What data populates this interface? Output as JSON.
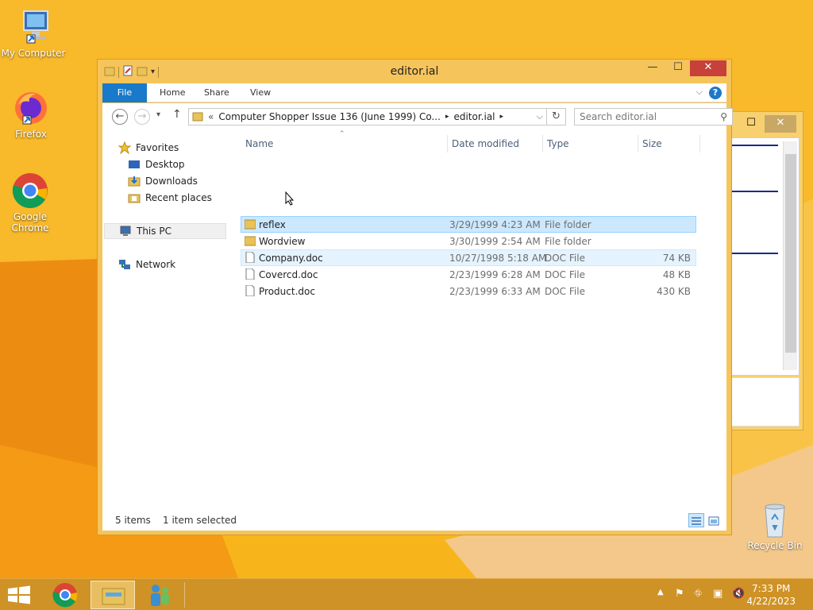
{
  "desktop": {
    "icons": [
      {
        "label": "My Computer"
      },
      {
        "label": "Firefox"
      },
      {
        "label": "Google Chrome"
      },
      {
        "label": "Recycle Bin"
      }
    ]
  },
  "window": {
    "title": "editor.ial",
    "ribbon_tabs": [
      "File",
      "Home",
      "Share",
      "View"
    ],
    "address": {
      "prefix": "«",
      "segments": [
        "Computer Shopper Issue 136 (June 1999) Co...",
        "editor.ial"
      ]
    },
    "search_placeholder": "Search editor.ial",
    "nav": {
      "favorites": "Favorites",
      "desktop": "Desktop",
      "downloads": "Downloads",
      "recent": "Recent places",
      "this_pc": "This PC",
      "network": "Network"
    },
    "columns": {
      "name": "Name",
      "date": "Date modified",
      "type": "Type",
      "size": "Size"
    },
    "files": [
      {
        "name": "reflex",
        "date": "3/29/1999 4:23 AM",
        "type": "File folder",
        "size": "",
        "kind": "folder"
      },
      {
        "name": "Wordview",
        "date": "3/30/1999 2:54 AM",
        "type": "File folder",
        "size": "",
        "kind": "folder"
      },
      {
        "name": "Company.doc",
        "date": "10/27/1998 5:18 AM",
        "type": "DOC File",
        "size": "74 KB",
        "kind": "doc"
      },
      {
        "name": "Covercd.doc",
        "date": "2/23/1999 6:28 AM",
        "type": "DOC File",
        "size": "48 KB",
        "kind": "doc"
      },
      {
        "name": "Product.doc",
        "date": "2/23/1999 6:33 AM",
        "type": "DOC File",
        "size": "430 KB",
        "kind": "doc"
      }
    ],
    "status": {
      "items": "5 items",
      "selected": "1 item selected"
    }
  },
  "taskbar": {
    "time": "7:33 PM",
    "date": "4/22/2023"
  },
  "colors": {
    "accent": "#1979ca",
    "selection": "#cce8ff",
    "close": "#c7403a"
  }
}
